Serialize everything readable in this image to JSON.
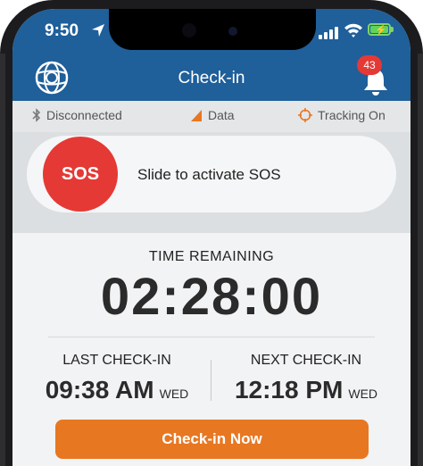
{
  "status_bar": {
    "time": "9:50"
  },
  "header": {
    "title": "Check-in",
    "notification_count": "43"
  },
  "connection": {
    "bluetooth": "Disconnected",
    "data": "Data",
    "tracking": "Tracking On"
  },
  "sos": {
    "button_label": "SOS",
    "slide_text": "Slide to activate SOS"
  },
  "timer": {
    "label": "TIME REMAINING",
    "value": "02:28:00"
  },
  "last_checkin": {
    "label": "LAST CHECK-IN",
    "time": "09:38 AM",
    "day": "WED"
  },
  "next_checkin": {
    "label": "NEXT CHECK-IN",
    "time": "12:18 PM",
    "day": "WED"
  },
  "actions": {
    "checkin_now": "Check-in Now"
  },
  "colors": {
    "header_blue": "#1f5f9a",
    "sos_red": "#e53935",
    "action_orange": "#e87722",
    "tracking_orange": "#e87722"
  }
}
